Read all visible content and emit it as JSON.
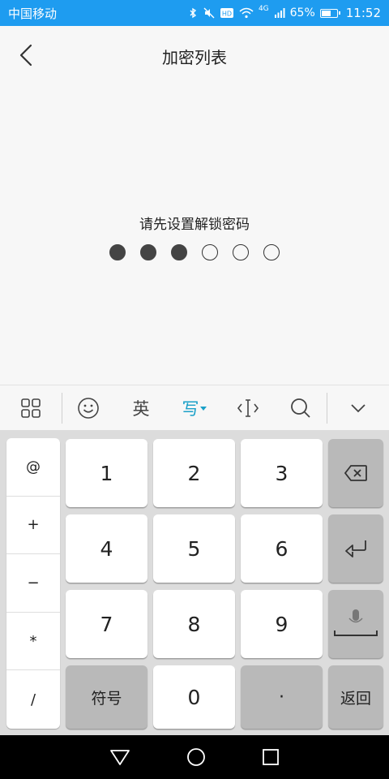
{
  "status_bar": {
    "carrier": "中国移动",
    "network": "4G",
    "battery": "65%",
    "battery_level": 0.65,
    "time": "11:52"
  },
  "header": {
    "title": "加密列表"
  },
  "lock": {
    "prompt": "请先设置解锁密码",
    "filled": 3,
    "total": 6
  },
  "ime_toolbar": {
    "english_label": "英",
    "handwrite_label": "写"
  },
  "keyboard": {
    "symbols": [
      "@",
      "+",
      "−",
      "*",
      "/"
    ],
    "digits": [
      "1",
      "2",
      "3",
      "4",
      "5",
      "6",
      "7",
      "8",
      "9",
      "0"
    ],
    "symbol_key_label": "符号",
    "dot_label": "·",
    "return_label": "返回"
  },
  "colors": {
    "status_bar": "#1e9cf0",
    "accent": "#1aa0c8",
    "dot_filled": "#444444"
  }
}
